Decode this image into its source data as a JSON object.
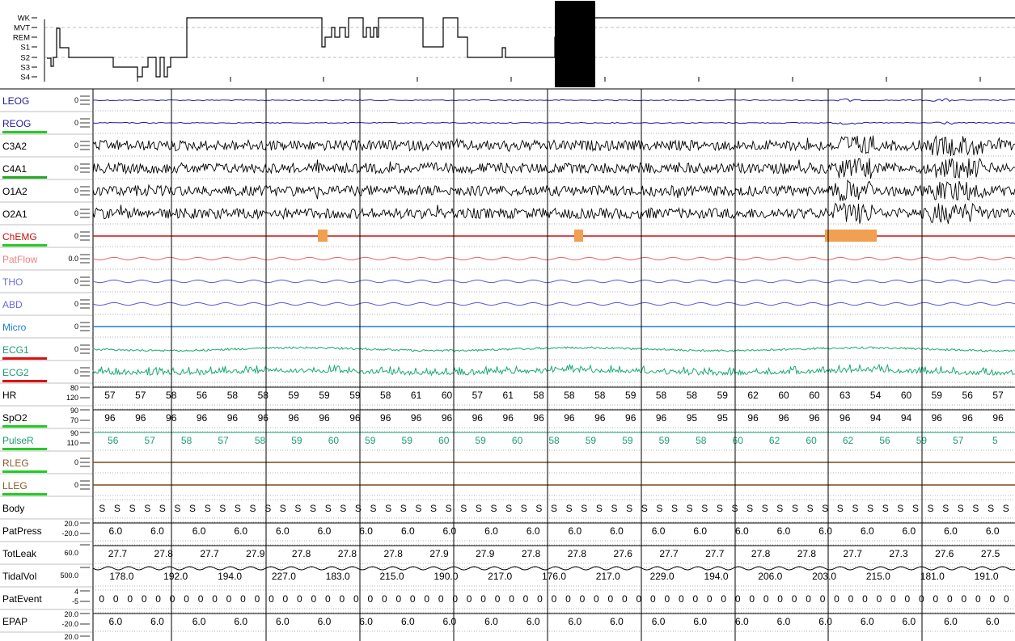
{
  "hypnogram": {
    "stages": [
      "WK",
      "MVT",
      "REM",
      "S1",
      "S2",
      "S3",
      "S4"
    ]
  },
  "channels": [
    {
      "name": "LEOG",
      "scale": [
        "0"
      ],
      "label_color": "#2020a0",
      "trace_color": "#1a1aa0",
      "kind": "eog",
      "underline_color": ""
    },
    {
      "name": "REOG",
      "scale": [
        "0"
      ],
      "label_color": "#2020a0",
      "trace_color": "#1a1aa0",
      "kind": "eog",
      "underline_color": "#22cc22"
    },
    {
      "name": "C3A2",
      "scale": [
        "0"
      ],
      "label_color": "#000000",
      "trace_color": "#000000",
      "kind": "eeg",
      "underline_color": ""
    },
    {
      "name": "C4A1",
      "scale": [
        "0"
      ],
      "label_color": "#000000",
      "trace_color": "#000000",
      "kind": "eeg",
      "underline_color": "#22aa22"
    },
    {
      "name": "O1A2",
      "scale": [
        "0"
      ],
      "label_color": "#000000",
      "trace_color": "#000000",
      "kind": "eeg",
      "underline_color": ""
    },
    {
      "name": "O2A1",
      "scale": [
        "0"
      ],
      "label_color": "#000000",
      "trace_color": "#000000",
      "kind": "eeg",
      "underline_color": ""
    },
    {
      "name": "ChEMG",
      "scale": [
        "0"
      ],
      "label_color": "#cc1111",
      "trace_color": "#cc1111",
      "kind": "emg",
      "underline_color": "#22cc22"
    },
    {
      "name": "PatFlow",
      "scale": [
        "0.0"
      ],
      "label_color": "#ee8080",
      "trace_color": "#ee6060",
      "kind": "wave",
      "underline_color": ""
    },
    {
      "name": "THO",
      "scale": [
        "0"
      ],
      "label_color": "#6a6ae0",
      "trace_color": "#5a5ad0",
      "kind": "wave",
      "underline_color": ""
    },
    {
      "name": "ABD",
      "scale": [
        "0"
      ],
      "label_color": "#6a6ae0",
      "trace_color": "#5a5ad0",
      "kind": "wave",
      "underline_color": ""
    },
    {
      "name": "Micro",
      "scale": [
        "0"
      ],
      "label_color": "#1a80d0",
      "trace_color": "#1a80d0",
      "kind": "flat",
      "underline_color": ""
    },
    {
      "name": "ECG1",
      "scale": [
        "0"
      ],
      "label_color": "#1aa070",
      "trace_color": "#1aaa70",
      "kind": "ecg",
      "underline_color": "#dd1111"
    },
    {
      "name": "ECG2",
      "scale": [
        "0"
      ],
      "label_color": "#1aa070",
      "trace_color": "#1aaa70",
      "kind": "ecg2",
      "underline_color": "#dd1111"
    },
    {
      "name": "HR",
      "scale": [
        "80",
        "120"
      ],
      "label_color": "#000000",
      "trace_color": "#000000",
      "kind": "num",
      "underline_color": "",
      "values": [
        "57",
        "57",
        "58",
        "56",
        "58",
        "58",
        "59",
        "59",
        "59",
        "58",
        "61",
        "60",
        "57",
        "61",
        "58",
        "58",
        "58",
        "59",
        "58",
        "58",
        "59",
        "62",
        "60",
        "60",
        "63",
        "54",
        "60",
        "59",
        "56",
        "57"
      ]
    },
    {
      "name": "SpO2",
      "scale": [
        "90",
        "70"
      ],
      "label_color": "#000000",
      "trace_color": "#000000",
      "kind": "num",
      "underline_color": "#22cc22",
      "values": [
        "96",
        "96",
        "96",
        "96",
        "96",
        "96",
        "96",
        "96",
        "96",
        "96",
        "96",
        "96",
        "96",
        "96",
        "96",
        "96",
        "96",
        "96",
        "96",
        "95",
        "95",
        "96",
        "96",
        "96",
        "96",
        "94",
        "94",
        "96",
        "96",
        "96"
      ]
    },
    {
      "name": "PulseR",
      "scale": [
        "90",
        "110"
      ],
      "label_color": "#1aa070",
      "trace_color": "#1aa070",
      "kind": "num",
      "underline_color": "#22cc22",
      "values": [
        "56",
        "57",
        "58",
        "57",
        "58",
        "59",
        "60",
        "59",
        "59",
        "60",
        "59",
        "60",
        "58",
        "59",
        "59",
        "59",
        "58",
        "60",
        "62",
        "60",
        "62",
        "56",
        "59",
        "57",
        "5"
      ]
    },
    {
      "name": "RLEG",
      "scale": [
        "0"
      ],
      "label_color": "#8a5a2a",
      "trace_color": "#7a4a1a",
      "kind": "flat",
      "underline_color": "#22cc22"
    },
    {
      "name": "LLEG",
      "scale": [
        "0"
      ],
      "label_color": "#8a5a2a",
      "trace_color": "#7a4a1a",
      "kind": "flat",
      "underline_color": "#22cc22"
    },
    {
      "name": "Body",
      "scale": [],
      "label_color": "#000000",
      "trace_color": "#000000",
      "kind": "num",
      "underline_color": "",
      "values": [
        "S",
        "S",
        "S",
        "S",
        "S",
        "S",
        "S",
        "S",
        "S",
        "S",
        "S",
        "S",
        "S",
        "S",
        "S",
        "S",
        "S",
        "S",
        "S",
        "S",
        "S",
        "S",
        "S",
        "S",
        "S",
        "S",
        "S",
        "S",
        "S",
        "S",
        "S",
        "S",
        "S",
        "S",
        "S",
        "S",
        "S",
        "S",
        "S",
        "S",
        "S",
        "S",
        "S",
        "S",
        "S",
        "S",
        "S",
        "S",
        "S",
        "S",
        "S",
        "S",
        "S",
        "S",
        "S",
        "S",
        "S",
        "S",
        "S",
        "S",
        "S"
      ]
    },
    {
      "name": "PatPress",
      "scale": [
        "20.0",
        "-20.0"
      ],
      "label_color": "#000000",
      "trace_color": "#000000",
      "kind": "num",
      "underline_color": "",
      "values": [
        "6.0",
        "6.0",
        "6.0",
        "6.0",
        "6.0",
        "6.0",
        "6.0",
        "6.0",
        "6.0",
        "6.0",
        "6.0",
        "6.0",
        "6.0",
        "6.0",
        "6.0",
        "6.0",
        "6.0",
        "6.0",
        "6.0",
        "6.0",
        "6.0",
        "6.0"
      ]
    },
    {
      "name": "TotLeak",
      "scale": [
        "60.0"
      ],
      "label_color": "#000000",
      "trace_color": "#000000",
      "kind": "num",
      "underline_color": "",
      "values": [
        "27.7",
        "27.8",
        "27.7",
        "27.9",
        "27.8",
        "27.8",
        "27.8",
        "27.9",
        "27.9",
        "27.8",
        "27.8",
        "27.6",
        "27.7",
        "27.7",
        "27.8",
        "27.8",
        "27.7",
        "27.3",
        "27.6",
        "27.5"
      ]
    },
    {
      "name": "TidalVol",
      "scale": [
        "500.0"
      ],
      "label_color": "#000000",
      "trace_color": "#000000",
      "kind": "num",
      "underline_color": "",
      "values": [
        "178.0",
        "192.0",
        "194.0",
        "227.0",
        "183.0",
        "215.0",
        "190.0",
        "217.0",
        "176.0",
        "217.0",
        "229.0",
        "194.0",
        "206.0",
        "203.0",
        "215.0",
        "181.0",
        "191.0"
      ]
    },
    {
      "name": "PatEvent",
      "scale": [
        "4",
        "-5"
      ],
      "label_color": "#000000",
      "trace_color": "#000000",
      "kind": "num",
      "underline_color": "",
      "values": [
        "0",
        "0",
        "0",
        "0",
        "0",
        "0",
        "0",
        "0",
        "0",
        "0",
        "0",
        "0",
        "0",
        "0",
        "0",
        "0",
        "0",
        "0",
        "0",
        "0",
        "0",
        "0",
        "0",
        "0",
        "0",
        "0",
        "0",
        "0",
        "0",
        "0",
        "0",
        "0",
        "0",
        "0",
        "0",
        "0",
        "0",
        "0",
        "0",
        "0",
        "0",
        "0",
        "0",
        "0",
        "0",
        "0",
        "0",
        "0",
        "0",
        "0",
        "0",
        "0",
        "0",
        "0",
        "0",
        "0",
        "0",
        "0",
        "0",
        "0",
        "0",
        "0",
        "0",
        "0",
        "0"
      ]
    },
    {
      "name": "EPAP",
      "scale": [
        "20.0",
        "-20.0"
      ],
      "label_color": "#000000",
      "trace_color": "#000000",
      "kind": "num",
      "underline_color": "",
      "values": [
        "6.0",
        "6.0",
        "6.0",
        "6.0",
        "6.0",
        "6.0",
        "6.0",
        "6.0",
        "6.0",
        "6.0",
        "6.0",
        "6.0",
        "6.0",
        "6.0",
        "6.0",
        "6.0",
        "6.0",
        "6.0",
        "6.0",
        "6.0",
        "6.0",
        "6.0"
      ]
    }
  ],
  "last_scale": "20.0",
  "colors": {
    "grid": "#999999",
    "epoch_line": "#000000",
    "emg_marker": "#f0a050",
    "current_epoch": "#000000"
  }
}
